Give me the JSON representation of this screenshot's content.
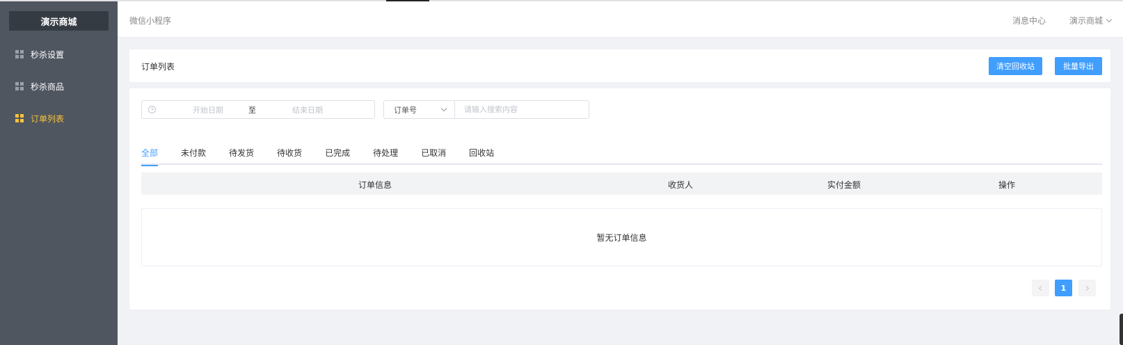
{
  "sidebar": {
    "brand": "演示商城",
    "items": [
      {
        "label": "秒杀设置",
        "active": false
      },
      {
        "label": "秒杀商品",
        "active": false
      },
      {
        "label": "订单列表",
        "active": true
      }
    ]
  },
  "header": {
    "mini_program": "微信小程序",
    "message_center": "消息中心",
    "shop_name": "演示商城"
  },
  "title_card": {
    "title": "订单列表",
    "clear_recycle_label": "清空回收站",
    "batch_export_label": "批量导出"
  },
  "filters": {
    "start_date_placeholder": "开始日期",
    "range_separator": "至",
    "end_date_placeholder": "结束日期",
    "search_field": "订单号",
    "search_placeholder": "请输入搜索内容"
  },
  "tabs": [
    {
      "label": "全部",
      "active": true
    },
    {
      "label": "未付款",
      "active": false
    },
    {
      "label": "待发货",
      "active": false
    },
    {
      "label": "待收货",
      "active": false
    },
    {
      "label": "已完成",
      "active": false
    },
    {
      "label": "待处理",
      "active": false
    },
    {
      "label": "已取消",
      "active": false
    },
    {
      "label": "回收站",
      "active": false
    }
  ],
  "table": {
    "columns": [
      "订单信息",
      "收货人",
      "实付金额",
      "操作"
    ],
    "empty_text": "暂无订单信息"
  },
  "pagination": {
    "current_page": "1"
  },
  "colors": {
    "primary": "#409eff",
    "sidebar_bg": "#4f5660",
    "active_menu": "#f7c33b"
  }
}
